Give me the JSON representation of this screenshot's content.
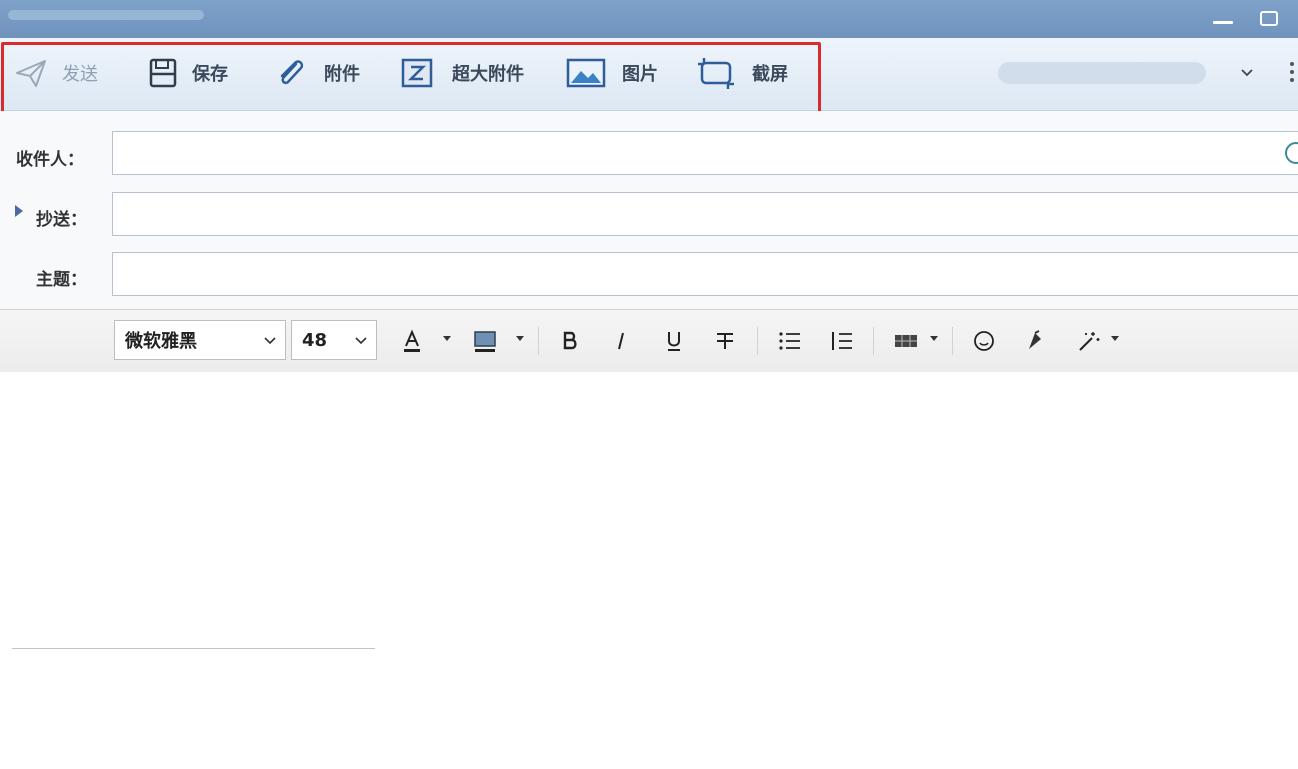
{
  "window": {
    "title": ""
  },
  "toolbar": {
    "send": "发送",
    "save": "保存",
    "attachment": "附件",
    "large_attachment": "超大附件",
    "picture": "图片",
    "screenshot": "截屏"
  },
  "fields": {
    "to_label": "收件人：",
    "cc_label": "抄送：",
    "subject_label": "主题：",
    "to_value": "",
    "cc_value": "",
    "subject_value": ""
  },
  "format": {
    "font": "微软雅黑",
    "size": "48"
  },
  "colors": {
    "highlight": "#d92b2b",
    "titlebar": "#7fa2c9"
  }
}
